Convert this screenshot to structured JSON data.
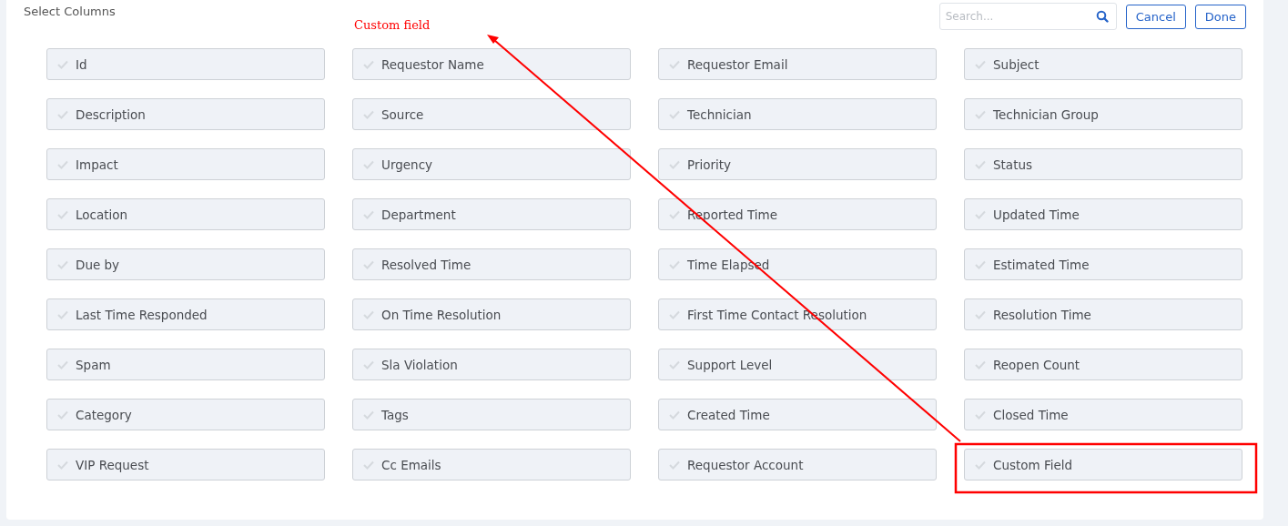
{
  "title": "Select Columns",
  "search": {
    "placeholder": "Search..."
  },
  "buttons": [
    "Cancel",
    "Done"
  ],
  "annotation": {
    "label": "Custom field"
  },
  "columns": [
    {
      "label": "Id",
      "checked": false
    },
    {
      "label": "Requestor Name",
      "checked": false
    },
    {
      "label": "Requestor Email",
      "checked": false
    },
    {
      "label": "Subject",
      "checked": false
    },
    {
      "label": "Description",
      "checked": false
    },
    {
      "label": "Source",
      "checked": false
    },
    {
      "label": "Technician",
      "checked": false
    },
    {
      "label": "Technician Group",
      "checked": false
    },
    {
      "label": "Impact",
      "checked": false
    },
    {
      "label": "Urgency",
      "checked": false
    },
    {
      "label": "Priority",
      "checked": false
    },
    {
      "label": "Status",
      "checked": false
    },
    {
      "label": "Location",
      "checked": false
    },
    {
      "label": "Department",
      "checked": false
    },
    {
      "label": "Reported Time",
      "checked": false
    },
    {
      "label": "Updated Time",
      "checked": false
    },
    {
      "label": "Due by",
      "checked": false
    },
    {
      "label": "Resolved Time",
      "checked": false
    },
    {
      "label": "Time Elapsed",
      "checked": false
    },
    {
      "label": "Estimated Time",
      "checked": false
    },
    {
      "label": "Last Time Responded",
      "checked": false
    },
    {
      "label": "On Time Resolution",
      "checked": false
    },
    {
      "label": "First Time Contact Resolution",
      "checked": false
    },
    {
      "label": "Resolution Time",
      "checked": false
    },
    {
      "label": "Spam",
      "checked": false
    },
    {
      "label": "Sla Violation",
      "checked": false
    },
    {
      "label": "Support Level",
      "checked": false
    },
    {
      "label": "Reopen Count",
      "checked": false
    },
    {
      "label": "Category",
      "checked": false
    },
    {
      "label": "Tags",
      "checked": false
    },
    {
      "label": "Created Time",
      "checked": false
    },
    {
      "label": "Closed Time",
      "checked": false
    },
    {
      "label": "VIP Request",
      "checked": false
    },
    {
      "label": "Cc Emails",
      "checked": false
    },
    {
      "label": "Requestor Account",
      "checked": false
    },
    {
      "label": "Custom Field",
      "checked": false
    }
  ]
}
